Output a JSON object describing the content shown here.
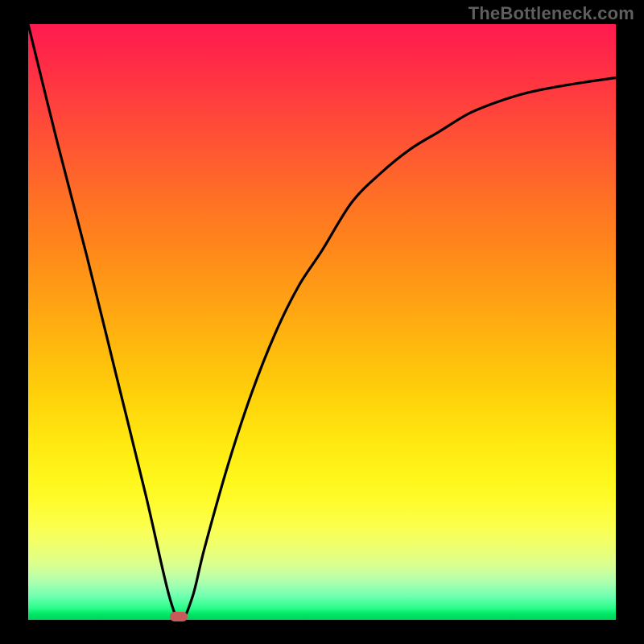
{
  "watermark": "TheBottleneck.com",
  "colors": {
    "frame": "#000000",
    "curve": "#000000",
    "marker": "#c85a5a"
  },
  "chart_data": {
    "type": "line",
    "title": "",
    "xlabel": "",
    "ylabel": "",
    "xlim": [
      0,
      100
    ],
    "ylim": [
      0,
      100
    ],
    "grid": false,
    "series": [
      {
        "name": "bottleneck-curve",
        "x": [
          0,
          5,
          10,
          15,
          20,
          24,
          26,
          28,
          30,
          34,
          38,
          42,
          46,
          50,
          55,
          60,
          65,
          70,
          75,
          80,
          85,
          90,
          95,
          100
        ],
        "y": [
          100,
          80,
          61,
          41,
          21,
          4,
          0,
          4,
          12,
          26,
          38,
          48,
          56,
          62,
          70,
          75,
          79,
          82,
          85,
          87,
          88.5,
          89.5,
          90.3,
          91
        ]
      }
    ],
    "marker": {
      "x": 25.6,
      "y": 0,
      "label": "optimal-point"
    },
    "background": "vertical-gradient red→orange→yellow→green (0%→100% of y)"
  }
}
